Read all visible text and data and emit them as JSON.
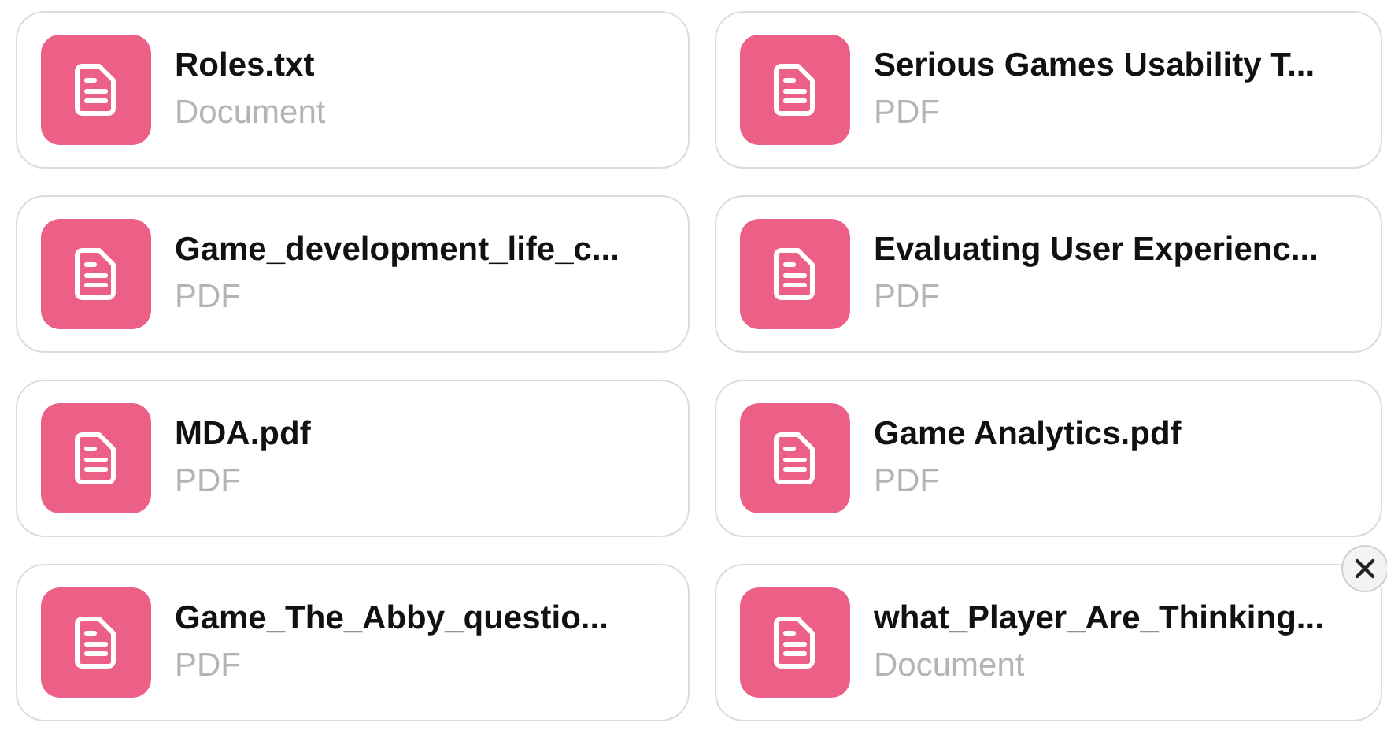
{
  "files": [
    {
      "name": "Roles.txt",
      "type": "Document"
    },
    {
      "name": "Serious Games Usability T...",
      "type": "PDF"
    },
    {
      "name": "Game_development_life_c...",
      "type": "PDF"
    },
    {
      "name": "Evaluating User Experienc...",
      "type": "PDF"
    },
    {
      "name": "MDA.pdf",
      "type": "PDF"
    },
    {
      "name": "Game Analytics.pdf",
      "type": "PDF"
    },
    {
      "name": "Game_The_Abby_questio...",
      "type": "PDF"
    },
    {
      "name": "what_Player_Are_Thinking...",
      "type": "Document",
      "removable": true
    }
  ]
}
